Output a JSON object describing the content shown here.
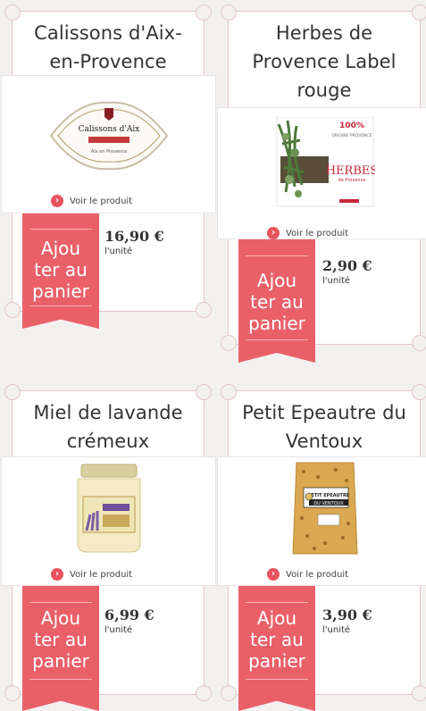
{
  "products": [
    {
      "title": "Calissons d'Aix-en-Provence",
      "view_label": "Voir le produit",
      "button_label": "Ajou ter au panier",
      "price": "16,90 €",
      "unit": "l'unité",
      "image": "calissons-box-image"
    },
    {
      "title": "Herbes de Provence Label rouge",
      "view_label": "Voir le produit",
      "button_label": "Ajou ter au panier",
      "price": "2,90 €",
      "unit": "l'unité",
      "image": "herbes-package-image"
    },
    {
      "title": "Miel de lavande crémeux",
      "view_label": "Voir le produit",
      "button_label": "Ajou ter au panier",
      "price": "6,99 €",
      "unit": "l'unité",
      "image": "honey-jar-image"
    },
    {
      "title": "Petit Epeautre du Ventoux",
      "view_label": "Voir le produit",
      "button_label": "Ajou ter au panier",
      "price": "3,90 €",
      "unit": "l'unité",
      "image": "epeautre-bag-image"
    }
  ],
  "brand_text": {
    "calissons": "Calissons d'Aix",
    "herbes_top": "100%",
    "herbes_mid": "ORIGINE PROVENCE",
    "herbes_main": "HERBES",
    "herbes_sub": "de Provence",
    "epeautre": "PETIT EPEAUTRE DU VENTOUX"
  },
  "colors": {
    "accent": "#ea6068",
    "frame": "#e4c6c6",
    "background": "#f2f1f0"
  }
}
